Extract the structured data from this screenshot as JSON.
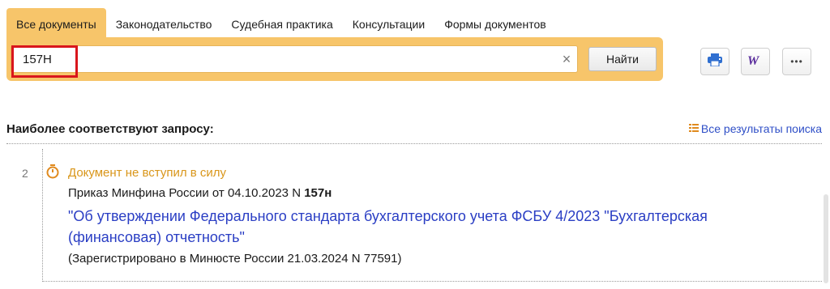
{
  "tabs": [
    "Все документы",
    "Законодательство",
    "Судебная практика",
    "Консультации",
    "Формы документов"
  ],
  "search": {
    "value": "157Н",
    "find_label": "Найти",
    "clear_glyph": "×"
  },
  "toolbar": {
    "print_icon": "printer-icon",
    "word_icon": "word-export-icon",
    "more_label": "•••"
  },
  "results": {
    "heading": "Наиболее соответствуют запросу:",
    "all_results_label": "Все результаты поиска",
    "items": [
      {
        "number": "2",
        "status": "Документ не вступил в силу",
        "doc_prefix": "Приказ Минфина России от 04.10.2023 N ",
        "doc_number": "157н",
        "title": "\"Об утверждении Федерального стандарта бухгалтерского учета ФСБУ 4/2023 \"Бухгалтерская (финансовая) отчетность\"",
        "note": "(Зарегистрировано в Минюсте России 21.03.2024 N 77591)"
      }
    ]
  },
  "colors": {
    "accent": "#f7c56a",
    "link": "#2a3ec4",
    "status": "#d9961a",
    "highlight": "#d9161c"
  }
}
